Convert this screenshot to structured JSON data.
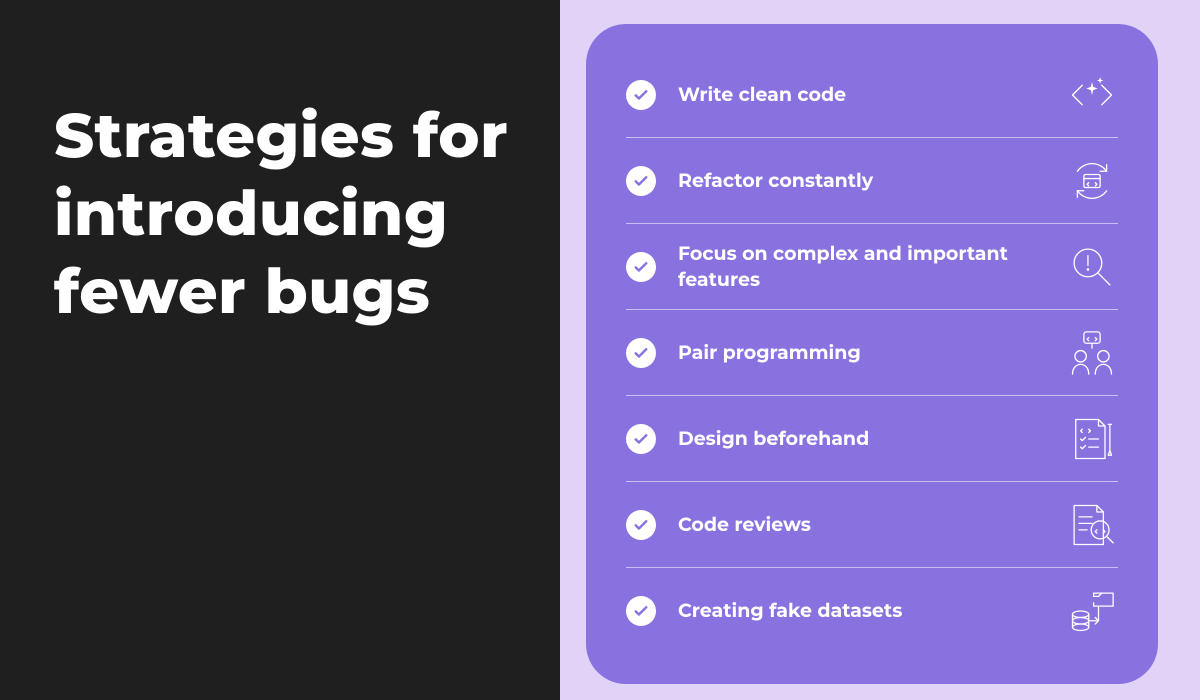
{
  "colors": {
    "page_bg": "#e1d3f8",
    "dark_panel": "#1f1f1f",
    "card": "#8a71e0",
    "text_light": "#ffffff",
    "check_tick": "#8a71e0"
  },
  "title": "Strategies for introducing fewer bugs",
  "items": [
    {
      "label": "Write clean code",
      "icon": "sparkle-code-icon"
    },
    {
      "label": "Refactor constantly",
      "icon": "refresh-code-icon"
    },
    {
      "label": "Focus on complex and important features",
      "icon": "magnifier-alert-icon"
    },
    {
      "label": "Pair programming",
      "icon": "pair-programming-icon"
    },
    {
      "label": "Design beforehand",
      "icon": "design-doc-icon"
    },
    {
      "label": "Code reviews",
      "icon": "code-review-icon"
    },
    {
      "label": "Creating fake datasets",
      "icon": "fake-dataset-icon"
    }
  ]
}
